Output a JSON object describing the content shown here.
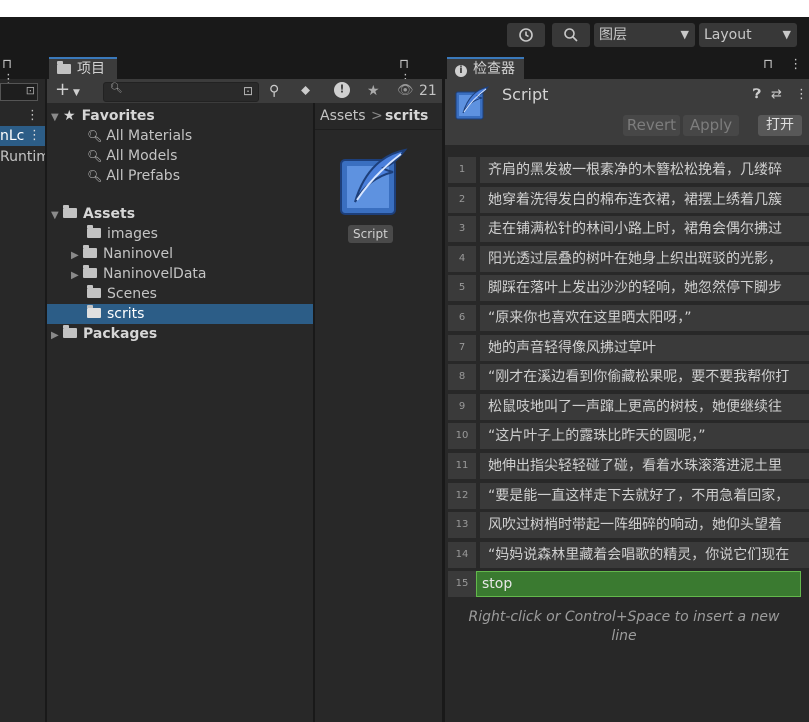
{
  "toolbar": {
    "history_icon": "history-icon",
    "search_icon": "search-icon",
    "layers_label": "图层",
    "layout_label": "Layout"
  },
  "left_panel": {
    "partial_1": "nLc",
    "partial_2": "Runtim"
  },
  "project": {
    "tab_label": "项目",
    "add_label": "+",
    "search_placeholder": "",
    "badge_count": "21",
    "favorites": {
      "label": "Favorites",
      "items": [
        "All Materials",
        "All Models",
        "All Prefabs"
      ]
    },
    "assets": {
      "label": "Assets",
      "items": [
        "images",
        "Naninovel",
        "NaninovelData",
        "Scenes",
        "scrits"
      ]
    },
    "packages_label": "Packages",
    "breadcrumb": {
      "root": "Assets",
      "sep": ">",
      "current": "scrits"
    },
    "file": {
      "name": "Script"
    }
  },
  "inspector": {
    "tab_label": "检查器",
    "title": "Script",
    "revert_label": "Revert",
    "apply_label": "Apply",
    "open_label": "打开",
    "lines": [
      {
        "num": "1",
        "text": "齐肩的黑发被一根素净的木簪松松挽着，几缕碎"
      },
      {
        "num": "2",
        "text": "她穿着洗得发白的棉布连衣裙，裙摆上绣着几簇"
      },
      {
        "num": "3",
        "text": "走在铺满松针的林间小路上时，裙角会偶尔拂过"
      },
      {
        "num": "4",
        "text": "阳光透过层叠的树叶在她身上织出斑驳的光影，"
      },
      {
        "num": "5",
        "text": "脚踩在落叶上发出沙沙的轻响，她忽然停下脚步"
      },
      {
        "num": "6",
        "text": "“原来你也喜欢在这里晒太阳呀，”"
      },
      {
        "num": "7",
        "text": "她的声音轻得像风拂过草叶"
      },
      {
        "num": "8",
        "text": "“刚才在溪边看到你偷藏松果呢，要不要我帮你打"
      },
      {
        "num": "9",
        "text": "松鼠吱地叫了一声蹿上更高的树枝，她便继续往"
      },
      {
        "num": "10",
        "text": "“这片叶子上的露珠比昨天的圆呢，”"
      },
      {
        "num": "11",
        "text": "她伸出指尖轻轻碰了碰，看着水珠滚落进泥土里"
      },
      {
        "num": "12",
        "text": "“要是能一直这样走下去就好了，不用急着回家，"
      },
      {
        "num": "13",
        "text": "风吹过树梢时带起一阵细碎的响动，她仰头望着"
      },
      {
        "num": "14",
        "text": "“妈妈说森林里藏着会唱歌的精灵，你说它们现在"
      },
      {
        "num": "15",
        "text": "stop"
      }
    ],
    "hint": "Right-click or Control+Space to insert a new line"
  },
  "colors": {
    "selection": "#2c5d87",
    "active_line": "#3a7a30",
    "accent": "#3a79bb"
  }
}
